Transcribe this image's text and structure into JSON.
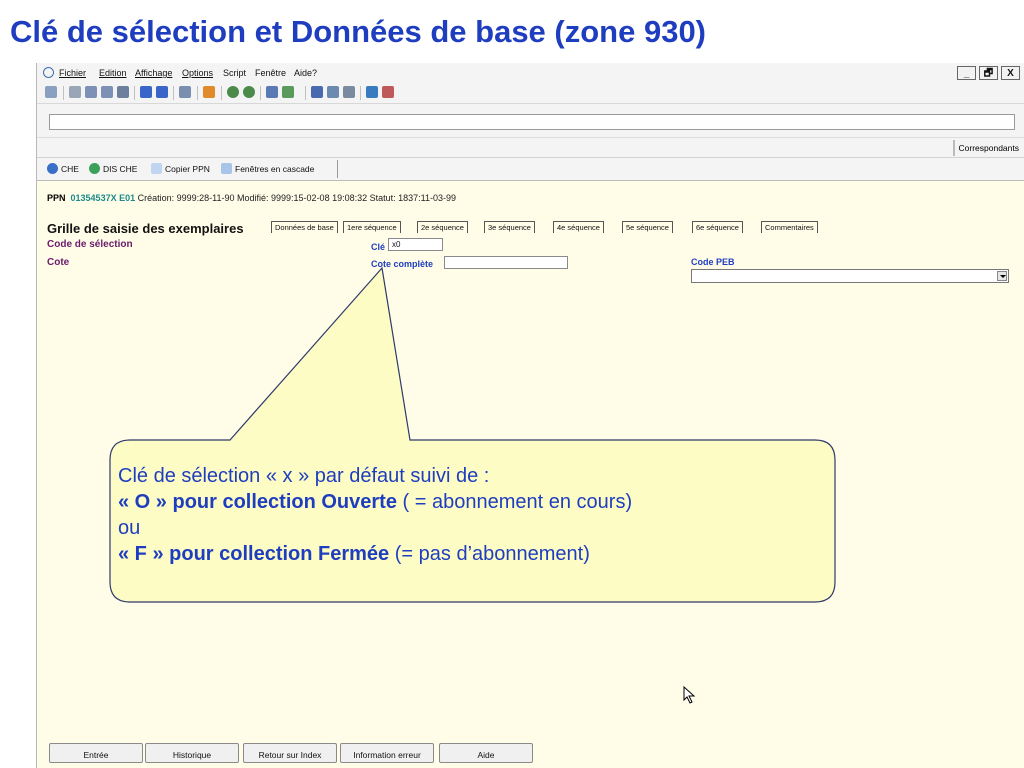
{
  "slide": {
    "title": "Clé de sélection et Données de base (zone 930)"
  },
  "menubar": {
    "items": [
      "Fichier",
      "Edition",
      "Affichage",
      "Options",
      "Script",
      "Fenêtre",
      "Aide?"
    ],
    "window_buttons": [
      "_",
      "🗗",
      "X"
    ]
  },
  "command": {
    "value": ""
  },
  "correspondants_label": "Correspondants",
  "quick_buttons": {
    "che": "CHE",
    "dis_che": "DIS CHE",
    "copier_ppn": "Copier PPN",
    "fenetres": "Fenêtres en cascade"
  },
  "record": {
    "ppn_label": "PPN",
    "ppn_value": "01354537X E01",
    "info": "Création: 9999:28-11-90 Modifié: 9999:15-02-08 19:08:32 Statut: 1837:11-03-99"
  },
  "grille": {
    "title": "Grille de saisie des exemplaires",
    "tabs": [
      "Données de base",
      "1ere séquence",
      "2e séquence",
      "3e séquence",
      "4e séquence",
      "5e séquence",
      "6e séquence",
      "Commentaires"
    ]
  },
  "form": {
    "code_selection_label": "Code de sélection",
    "cote_label": "Cote",
    "cle_label": "Clé",
    "cle_value": "x0",
    "cote_complete_label": "Cote complète",
    "cote_complete_value": "",
    "code_peb_label": "Code PEB",
    "code_peb_value": ""
  },
  "footer": {
    "entree": "Entrée",
    "historique": "Historique",
    "retour": "Retour sur Index",
    "info_erreur": "Information erreur",
    "aide": "Aide"
  },
  "callout": {
    "line1": "Clé de sélection «  x » par défaut suivi de :",
    "line2_bold": "« O »  pour collection Ouverte",
    "line2_rest": " ( = abonnement en cours)",
    "line3": "ou",
    "line4_bold": "« F » pour collection Fermée",
    "line4_rest": " (= pas d’abonnement)"
  },
  "colors": {
    "title_blue": "#1f3ebf",
    "app_bg": "#fffde8",
    "callout_fill": "#fdfcc4",
    "callout_border": "#2f3a6b",
    "label_purple": "#6a1b6a",
    "ppn_teal": "#1a8a8a"
  }
}
